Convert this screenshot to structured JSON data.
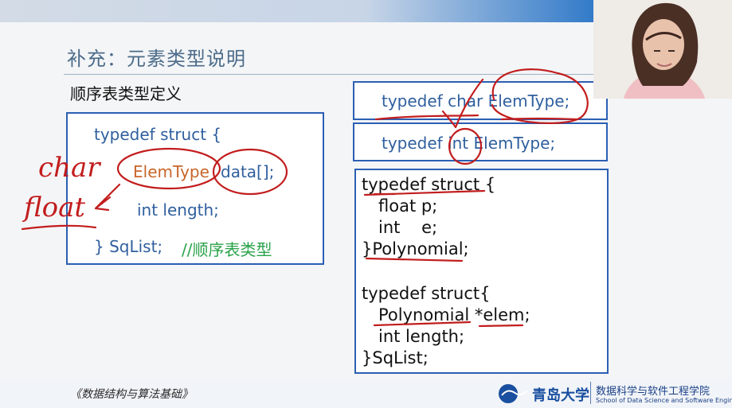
{
  "slide": {
    "title": "补充：元素类型说明",
    "subtitle": "顺序表类型定义",
    "left_box": {
      "lines": [
        "typedef struct {",
        "ElemType",
        "data[];",
        "int length;",
        "} SqList;",
        "//顺序表类型"
      ]
    },
    "right_top_box": {
      "text": "typedef char ElemType;"
    },
    "right_mid_box": {
      "text": "typedef int ElemType;"
    },
    "right_code_box": {
      "lines": [
        "typedef struct {",
        "float p;",
        "int    e;",
        "}Polynomial;",
        "typedef struct{",
        "Polynomial *elem;",
        "int length;",
        "}SqList;"
      ]
    },
    "handwriting": {
      "word_1": "char",
      "word_2": "float"
    }
  },
  "footer": {
    "course_title": "《数据结构与算法基础》",
    "university": "青岛大学",
    "school_cn": "数据科学与软件工程学院",
    "school_en": "School of Data Science and Software Engineering"
  },
  "colors": {
    "box_border": "#2b5fb3",
    "code_blue": "#2f5f9e",
    "elemtype_orange": "#c8662a",
    "comment_green": "#2aa24a",
    "ink_red": "#c21d1d"
  }
}
